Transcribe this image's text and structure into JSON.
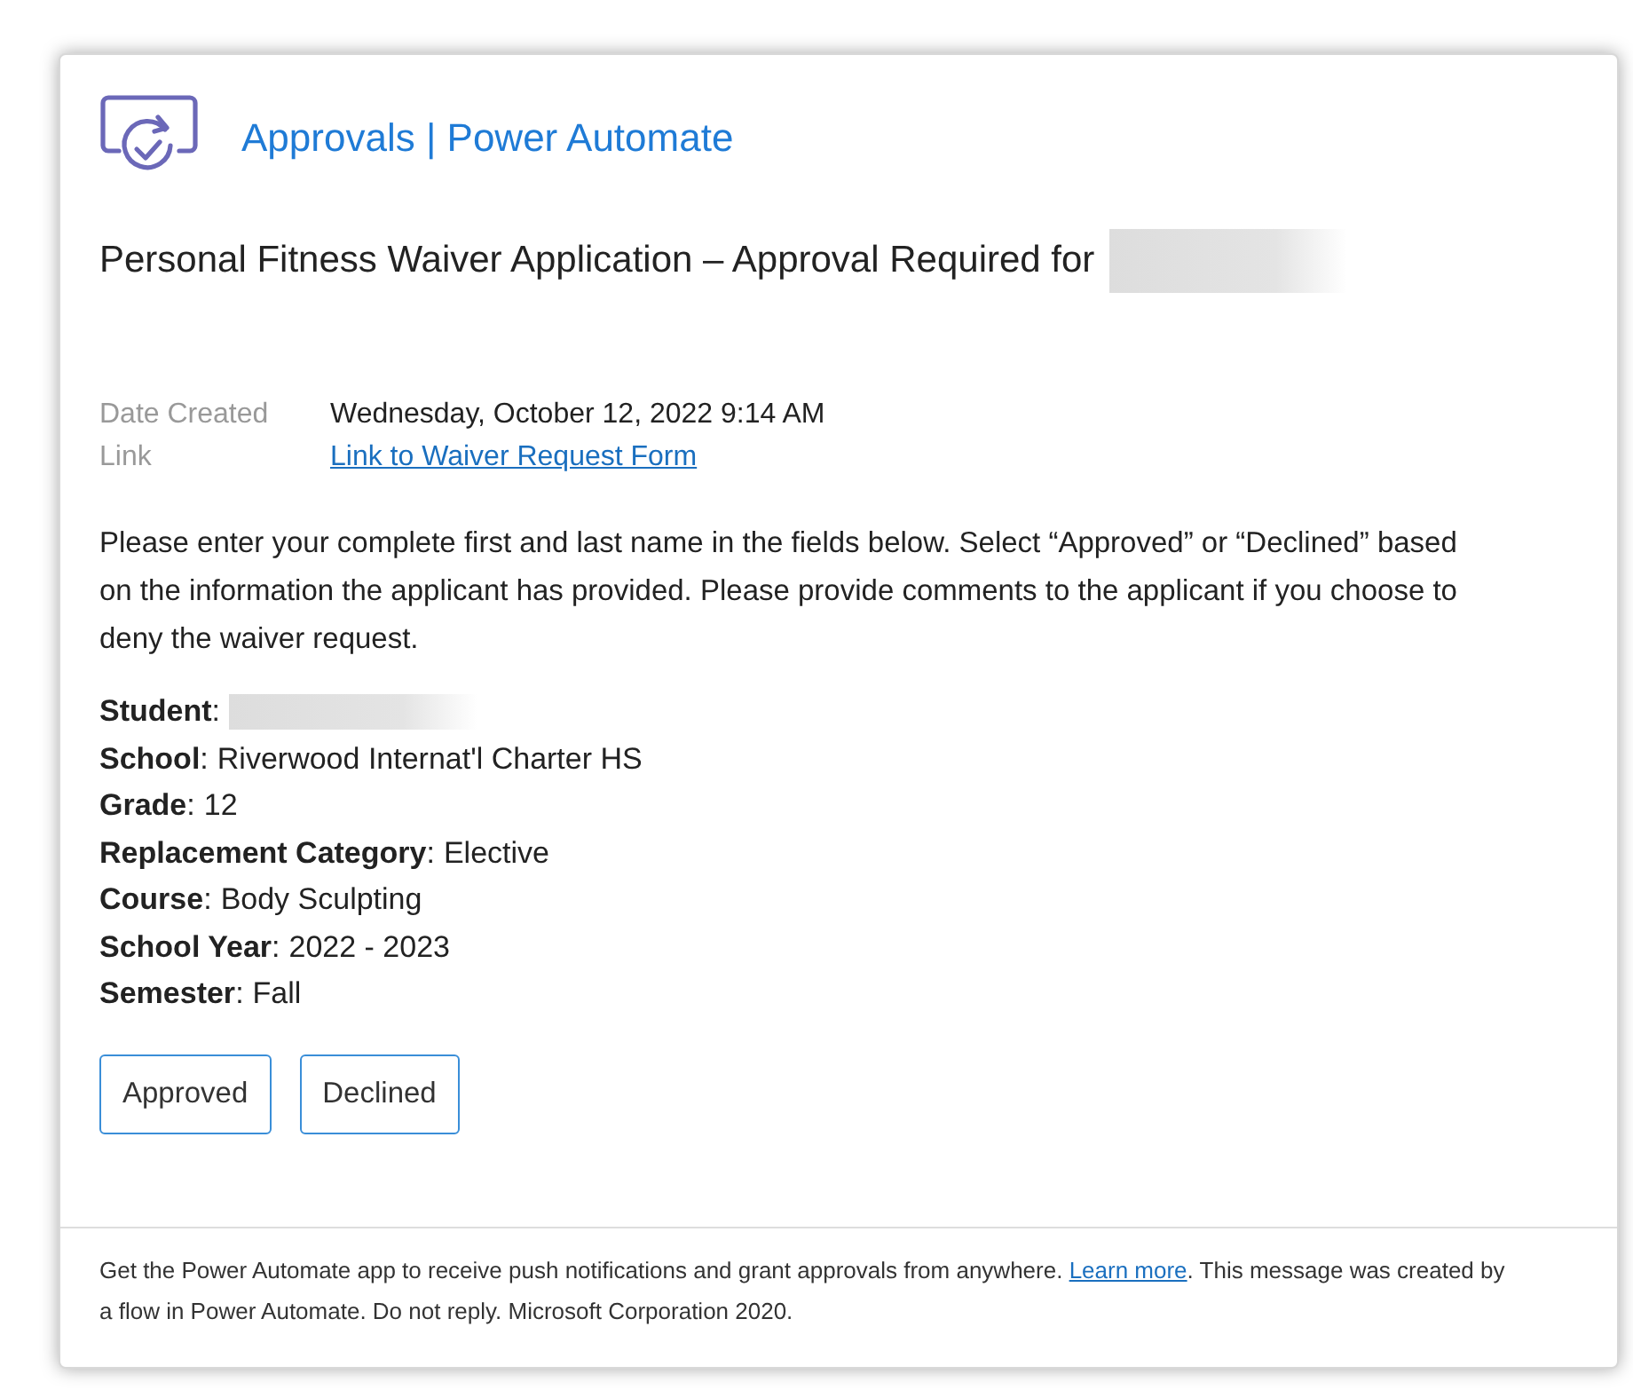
{
  "header": {
    "title": "Approvals | Power Automate"
  },
  "subject": {
    "text": "Personal Fitness Waiver Application – Approval Required for",
    "redacted": true
  },
  "meta": [
    {
      "label": "Date Created",
      "value": "Wednesday, October 12, 2022 9:14 AM",
      "kind": "text"
    },
    {
      "label": "Link",
      "value": "Link to Waiver Request Form",
      "kind": "link"
    }
  ],
  "instructions": "Please enter your complete first and last name in the fields below.  Select “Approved” or “Declined” based on the information the applicant has provided.  Please provide comments to the applicant if you choose to deny the waiver request.",
  "details": [
    {
      "label": "**Student**:",
      "redacted": true
    },
    {
      "label": "**School**:",
      "value": "Riverwood Internat'l Charter HS",
      "redacted": false
    },
    {
      "label": "**Grade**:",
      "value": "12",
      "redacted": false
    },
    {
      "label": "**Replacement Category**:",
      "value": "Elective",
      "redacted": false
    },
    {
      "label": "**Course**:",
      "value": "Body Sculpting",
      "redacted": false
    },
    {
      "label": "**School Year**:",
      "value": "2022 - 2023",
      "redacted": false
    },
    {
      "label": "**Semester**:",
      "value": "Fall",
      "redacted": false
    }
  ],
  "buttons": [
    "Approved",
    "Declined"
  ],
  "footer": {
    "before": "Get the Power Automate app to receive push notifications and grant approvals from anywhere.",
    "link": "Learn more",
    "after": ". This message was created by a flow in Power Automate. Do not reply. Microsoft Corporation 2020."
  }
}
